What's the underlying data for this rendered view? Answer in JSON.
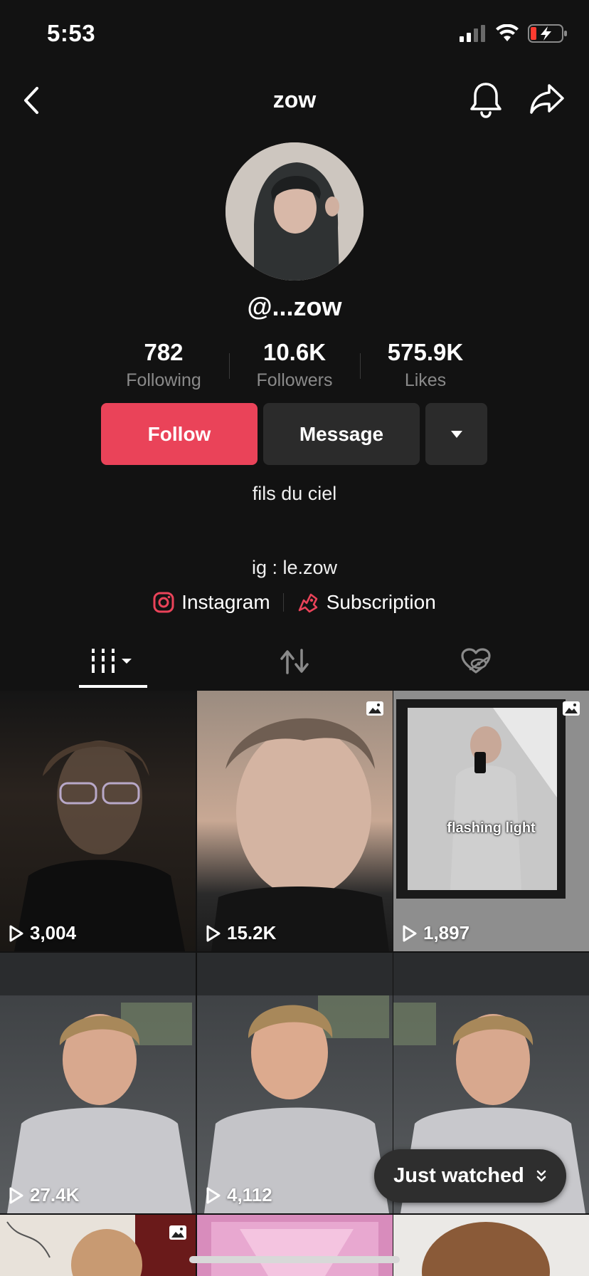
{
  "status_bar": {
    "time": "5:53"
  },
  "header": {
    "title": "zow"
  },
  "profile": {
    "handle": "@...zow",
    "stats": [
      {
        "value": "782",
        "label": "Following"
      },
      {
        "value": "10.6K",
        "label": "Followers"
      },
      {
        "value": "575.9K",
        "label": "Likes"
      }
    ],
    "bio_line1": "fils du ciel",
    "bio_line2": "ig : le.zow",
    "links": [
      {
        "label": "Instagram",
        "icon": "instagram-icon"
      },
      {
        "label": "Subscription",
        "icon": "subscription-icon"
      }
    ]
  },
  "actions": {
    "follow_label": "Follow",
    "message_label": "Message"
  },
  "tabs": [
    {
      "name": "videos",
      "icon": "grid-videos-icon",
      "active": true
    },
    {
      "name": "reposts",
      "icon": "repost-icon",
      "active": false
    },
    {
      "name": "liked",
      "icon": "liked-hidden-icon",
      "active": false
    }
  ],
  "videos": [
    {
      "views": "3,004",
      "photo": false,
      "overlay": ""
    },
    {
      "views": "15.2K",
      "photo": true,
      "overlay": ""
    },
    {
      "views": "1,897",
      "photo": true,
      "overlay": "flashing light"
    },
    {
      "views": "27.4K",
      "photo": false,
      "overlay": ""
    },
    {
      "views": "4,112",
      "photo": false,
      "overlay": ""
    }
  ],
  "just_watched": {
    "label": "Just watched"
  },
  "colors": {
    "accent": "#ea4359",
    "background": "#121212",
    "button": "#2b2b2b"
  }
}
